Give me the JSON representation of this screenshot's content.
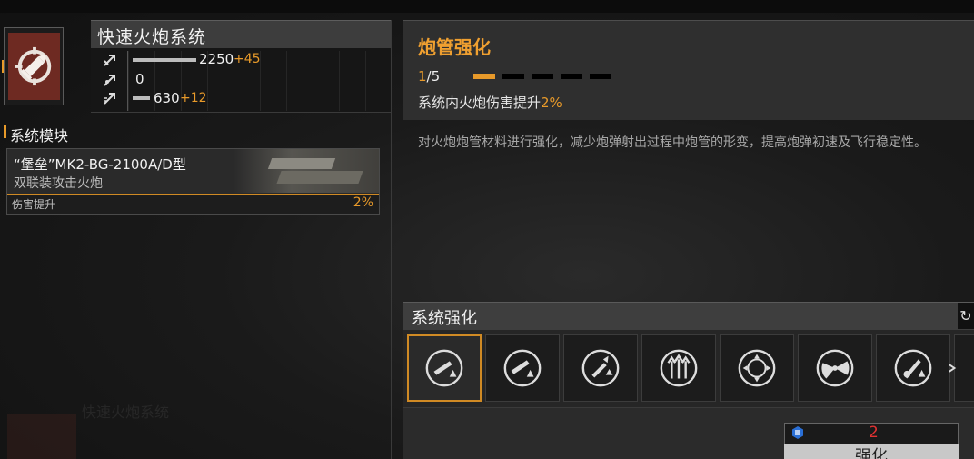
{
  "system": {
    "title": "快速火炮系统",
    "stats": [
      {
        "icon": "attack-stat-icon",
        "value": "2250",
        "bonus": "+45",
        "fill": 0.27
      },
      {
        "icon": "penetration-stat-icon",
        "value": "0",
        "bonus": "",
        "fill": 0
      },
      {
        "icon": "rate-stat-icon",
        "value": "630",
        "bonus": "+12",
        "fill": 0.07
      }
    ]
  },
  "modules": {
    "section_title": "系统模块",
    "card": {
      "name": "“堡垒”MK2-BG-2100A/D型",
      "subtitle": "双联装攻击火炮",
      "stat_label": "伤害提升",
      "stat_value": "2%"
    }
  },
  "detail": {
    "title": "炮管强化",
    "level_current": "1",
    "level_max": "/5",
    "level_progress": 0.2,
    "effect_prefix": "系统内火炮伤害提升",
    "effect_value": "2%",
    "description": "对火炮炮管材料进行强化，减少炮弹射出过程中炮管的形变，提高炮弹初速及飞行稳定性。"
  },
  "enhance": {
    "title": "系统强化",
    "refresh_icon": "refresh-icon",
    "slots": [
      {
        "icon": "barrel-upgrade-icon",
        "selected": true
      },
      {
        "icon": "cannon-boost-icon",
        "selected": false
      },
      {
        "icon": "shell-upgrade-icon",
        "selected": false
      },
      {
        "icon": "triple-arrow-icon",
        "selected": false
      },
      {
        "icon": "crosshair-icon",
        "selected": false
      },
      {
        "icon": "radar-icon",
        "selected": false
      },
      {
        "icon": "guitar-cannon-icon",
        "selected": false
      },
      {
        "icon": "partial-slot-icon",
        "selected": false
      }
    ],
    "cost_value": "2",
    "button_label": "强化"
  },
  "background": {
    "ghost_title": "快速火炮系统"
  },
  "colors": {
    "accent": "#e89a2a",
    "title": "#f0a030",
    "cost": "#e03232",
    "icon_red": "#6e2a22"
  }
}
